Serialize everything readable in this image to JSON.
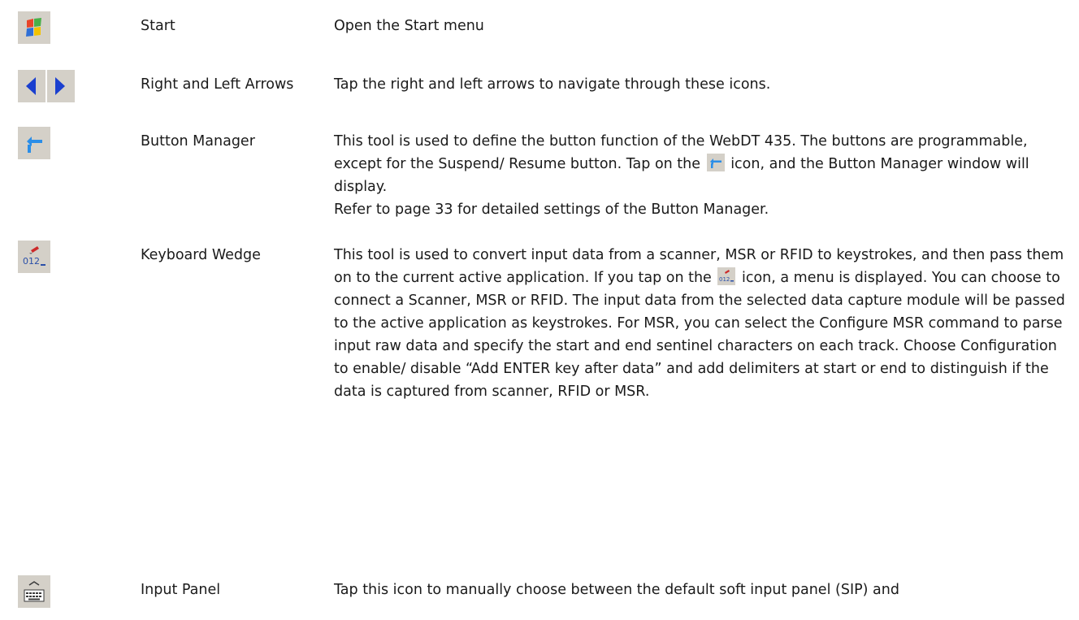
{
  "rows": [
    {
      "icon": "windows-start-flag-icon",
      "name": "Start",
      "desc": [
        "Open the Start menu"
      ]
    },
    {
      "icon": "left-right-arrows-icon",
      "name": "Right and Left Arrows",
      "desc": [
        "Tap the right and left arrows to navigate through these icons."
      ]
    },
    {
      "icon": "button-manager-icon",
      "name": "Button Manager",
      "desc_a": "This tool is used to define the button function of the WebDT 435. The buttons are programmable, except for the Suspend/ Resume button. Tap on the",
      "desc_b": "icon, and the Button Manager window will display.",
      "desc_c": "Refer to page 33 for detailed settings of the Button Manager."
    },
    {
      "icon": "keyboard-wedge-icon",
      "name": "Keyboard Wedge",
      "desc_a": "This tool is used to convert input data from a scanner, MSR or RFID to keystrokes, and then pass them on to the current active application. If you tap on the",
      "desc_b": "icon, a menu is displayed. You can choose to connect a Scanner, MSR or RFID. The input data from the selected data capture module will be passed to the active application as keystrokes. For MSR, you can select the Configure MSR command to parse input raw data and specify the start and end sentinel characters on each track. Choose Configuration to enable/ disable “Add ENTER key after data” and add delimiters at start or end to distinguish if the data is captured from scanner, RFID or MSR."
    },
    {
      "icon": "input-panel-keyboard-icon",
      "name": "Input Panel",
      "desc": [
        "Tap this icon to manually choose between the default soft input panel (SIP) and"
      ]
    }
  ],
  "colors": {
    "arrow_blue": "#1a3fcf",
    "icon_bg": "#d4d0c8",
    "text": "#1a1a1a"
  }
}
